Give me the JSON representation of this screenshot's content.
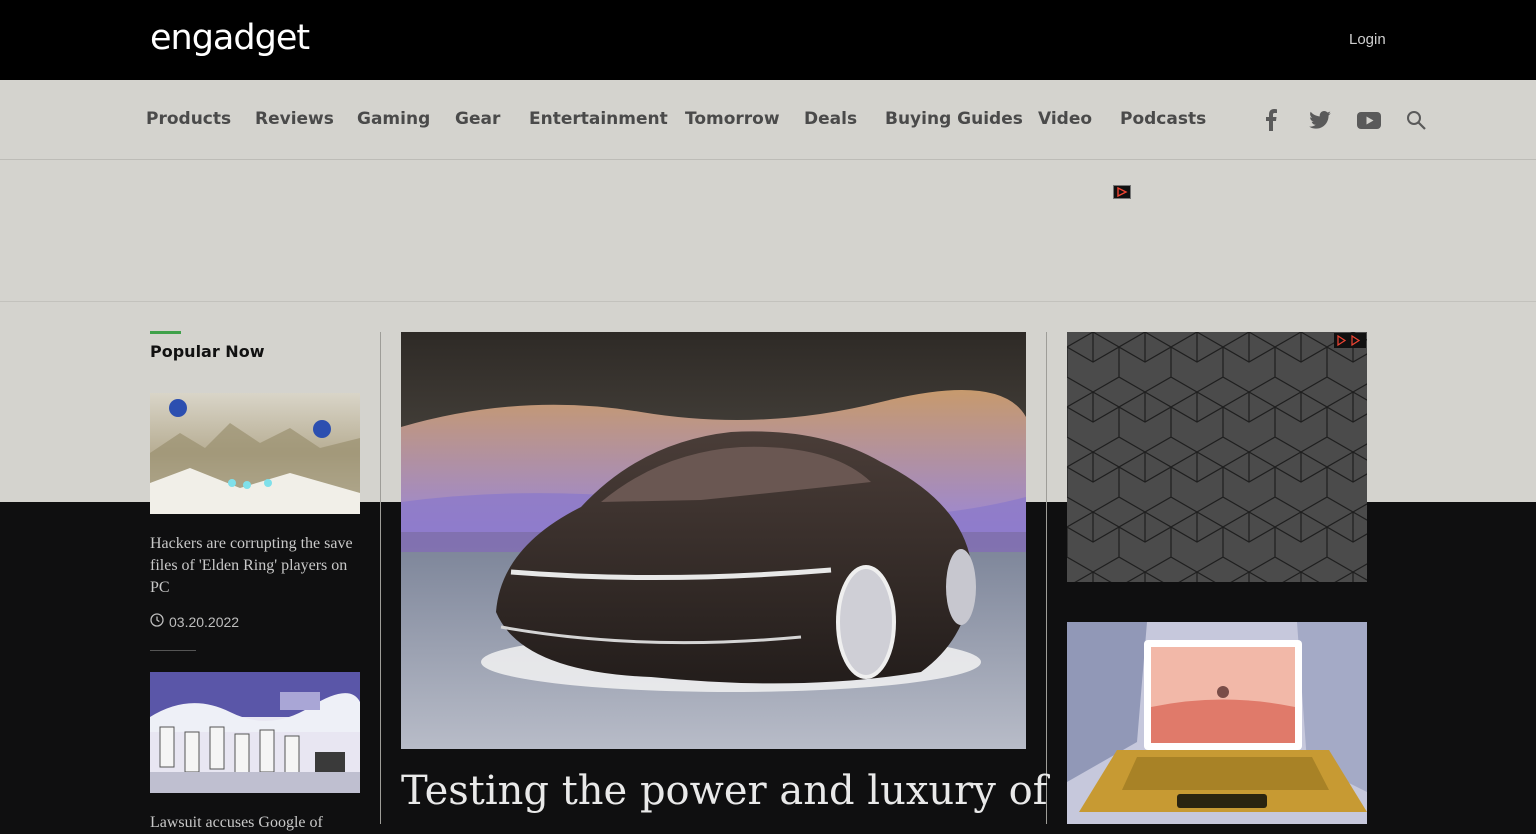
{
  "header": {
    "logo_text": "engadget",
    "login_label": "Login"
  },
  "nav": {
    "items": [
      "Products",
      "Reviews",
      "Gaming",
      "Gear",
      "Entertainment",
      "Tomorrow",
      "Deals",
      "Buying Guides",
      "Video",
      "Podcasts"
    ],
    "social_icons": [
      "facebook-icon",
      "twitter-icon",
      "youtube-icon",
      "search-icon"
    ]
  },
  "sidebar": {
    "section_title": "Popular Now",
    "articles": [
      {
        "headline": "Hackers are corrupting the save files of 'Elden Ring' players on PC",
        "date": "03.20.2022"
      },
      {
        "headline": "Lawsuit accuses Google of"
      }
    ]
  },
  "main": {
    "hero_title": "Testing the power and luxury of"
  },
  "colors": {
    "topbar": "#000000",
    "nav_bg": "#d4d3ce",
    "page_dark": "#0f0f10",
    "accent_green": "#3fa14a"
  }
}
